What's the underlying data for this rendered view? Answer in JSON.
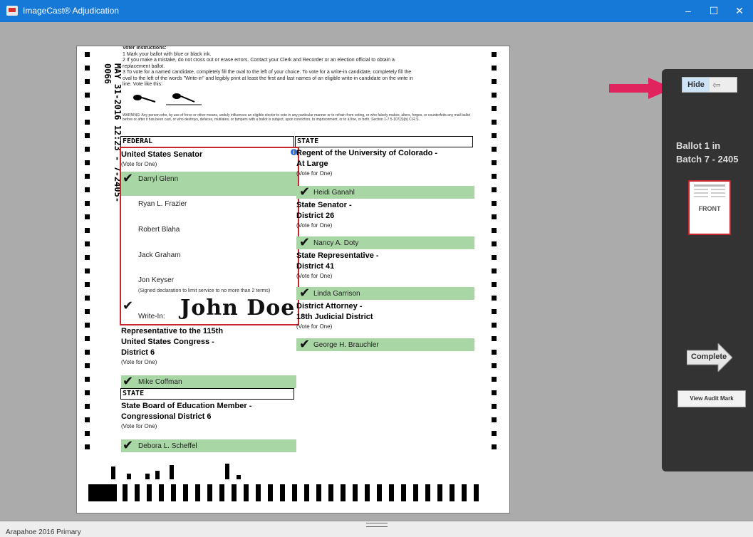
{
  "window": {
    "title": "ImageCast® Adjudication",
    "min": "–",
    "max": "☐",
    "close": "✕"
  },
  "ballot": {
    "vertical_stamp": "MAY 31-2016 12:23 - 7-2405-0066",
    "instructions": {
      "title": "Voter Instructions:",
      "line1": "1    Mark your ballot with blue or black ink.",
      "line2": "2    If you make a mistake, do not cross out or erase errors. Contact your Clerk and Recorder or an election official to obtain a",
      "line2b": "      replacement ballot.",
      "line3": "3    To vote for a named candidate, completely fill the oval to the left of your choice.  To vote for a write-in candidate, completely fill the",
      "line3b": "      oval to the left of the words \"Write-in\" and legibly print at least the first and last names of an eligible write-in candidate on the write in",
      "line3c": "      line.  Vote like this:"
    },
    "warning": "WARNING: Any person who, by use of force or other means, unduly influences an eligible elector to vote in any particular manner or to refrain from voting, or who falsely makes, alters, forges, or counterfeits any mail ballot before or after it has been cast, or who destroys, defaces, mutilates, or tampers with a ballot is subject, upon conviction, to imprisonment, or to a fine, or both. Section 1-7.5-107(3)(b) C.R.S.",
    "federal_header": "FEDERAL",
    "state_header_right": "STATE",
    "state_header_left": "STATE",
    "senator": {
      "title": "United States Senator",
      "vote_for": "(Vote for One)",
      "candidates": [
        "Darryl Glenn",
        "Ryan L. Frazier",
        "Robert Blaha",
        "Jack Graham",
        "Jon Keyser"
      ],
      "keyser_note": "(Signed declaration to limit service to no more than 2 terms)",
      "writein_label": "Write-In:",
      "writein_value": "John Doe"
    },
    "rep": {
      "title1": "Representative to the 115th",
      "title2": "United States Congress -",
      "title3": "District 6",
      "vote_for": "(Vote for One)",
      "candidate": "Mike Coffman"
    },
    "education": {
      "title1": "State Board of Education Member -",
      "title2": "Congressional District 6",
      "vote_for": "(Vote for One)",
      "candidate": "Debora L. Scheffel"
    },
    "regent": {
      "title1": "Regent of the University of Colorado -",
      "title2": "At Large",
      "vote_for": "(Vote for One)",
      "candidate": "Heidi Ganahl"
    },
    "state_senator": {
      "title1": "State Senator -",
      "title2": "District 26",
      "vote_for": "(Vote for One)",
      "candidate": "Nancy A. Doty"
    },
    "state_rep": {
      "title1": "State Representative -",
      "title2": "District 41",
      "vote_for": "(Vote for One)",
      "candidate": "Linda Garrison"
    },
    "da": {
      "title1": "District Attorney -",
      "title2": "18th Judicial District",
      "vote_for": "(Vote for One)",
      "candidate": "George H. Brauchler"
    }
  },
  "panel": {
    "hide_label": "Hide",
    "batch_line1": "Ballot 1 in",
    "batch_line2": "Batch 7 - 2405",
    "thumb_label": "FRONT",
    "complete_label": "Complete",
    "audit_label": "View Audit Mark"
  },
  "status": {
    "text": "Arapahoe 2016 Primary"
  },
  "colors": {
    "titlebar": "#1779d7",
    "marked": "#a9d6a5",
    "selection": "#c8262d",
    "panel": "#333333",
    "arrow": "#e0245e"
  }
}
